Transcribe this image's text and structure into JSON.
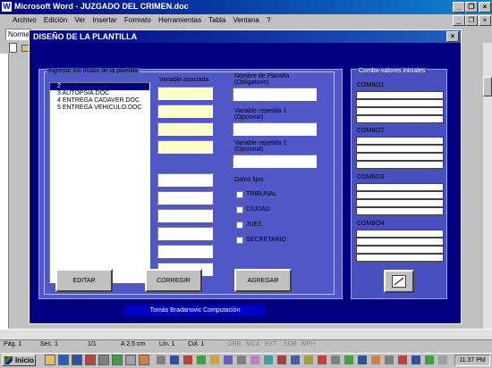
{
  "window": {
    "title": "Microsoft Word - JUZGADO DEL CRIMEN.doc"
  },
  "menu": [
    "Archivo",
    "Edición",
    "Ver",
    "Insertar",
    "Formato",
    "Herramientas",
    "Tabla",
    "Ventana",
    "?"
  ],
  "toolbar": {
    "style_value": "Norma"
  },
  "dialog": {
    "title": "DISEÑO DE LA PLANTILLA",
    "group_left_label": "Ingresar los títulos de la plantilla",
    "list_items": [
      "2",
      "3   AUTOPSIA.DOC",
      "4   ENTREGA CADAVER.DOC",
      "5   ENTREGA VEHICULO.DOC"
    ],
    "variable_header": "Variable asociada",
    "nombre_label": "Nombre de Plantilla",
    "nombre_sub": "(Obligatorio)",
    "var1_label": "Variable repetida 1",
    "var1_sub": "(Opcional)",
    "var2_label": "Variable repetida 2",
    "var2_sub": "(Opcional)",
    "datos_fijos": "Datos fijos",
    "checks": [
      "TRIBUNAL",
      "CIUDAD",
      "JUEZ",
      "SECRETARIO"
    ],
    "buttons": {
      "editar": "EDITAR",
      "corregir": "CORREGIR",
      "agregar": "AGREGAR"
    },
    "combo_group_label": "Combo-valores iniciales",
    "combos": [
      "COMBO1",
      "COMBO2",
      "COMBO3",
      "COMBO4"
    ],
    "footer": "Tomás Bradanovic Computación"
  },
  "statusbar": {
    "pag": "Pág. 1",
    "sec": "Sec. 1",
    "count": "1/1",
    "pos": "A 2,5 cm",
    "lin": "Lín. 1",
    "col": "Col. 1",
    "modes": [
      "GRB",
      "MCA",
      "EXT",
      "SOB",
      "WPH"
    ]
  },
  "taskbar": {
    "start": "Inicio",
    "clock": "11:37 PM"
  },
  "colors": {
    "dialog_bg": "#000080",
    "panel_bg": "#5058c8",
    "combo_panel": "#4850c0",
    "footer_bg": "#0000c8"
  }
}
